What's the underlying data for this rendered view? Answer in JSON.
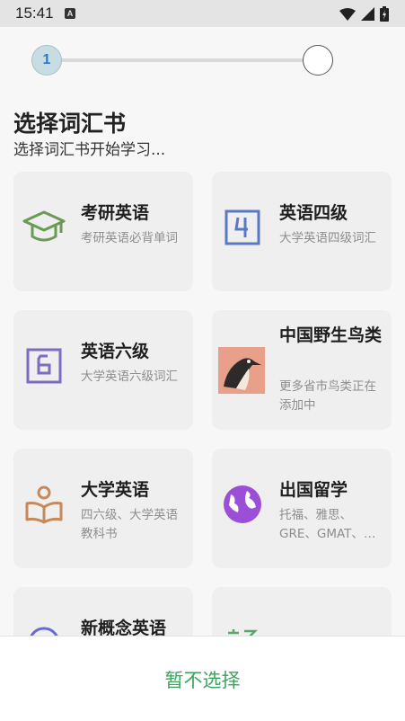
{
  "status_bar": {
    "time": "15:41",
    "notification_icon": "a-icon"
  },
  "stepper": {
    "current_step": "1",
    "total_steps": 2
  },
  "header": {
    "title": "选择词汇书",
    "subtitle": "选择词汇书开始学习..."
  },
  "books": [
    {
      "name": "考研英语",
      "desc": "考研英语必背单词",
      "icon": "graduation-cap-icon",
      "color": "#6b9a57"
    },
    {
      "name": "英语四级",
      "desc": "大学英语四级词汇",
      "icon": "number-4-icon",
      "color": "#5a79c4"
    },
    {
      "name": "英语六级",
      "desc": "大学英语六级词汇",
      "icon": "number-6-icon",
      "color": "#7d6cc0"
    },
    {
      "name": "中国野生鸟类",
      "desc": "更多省市鸟类正在添加中",
      "icon": "bird-image",
      "color": "#e9a08a"
    },
    {
      "name": "大学英语",
      "desc": "四六级、大学英语教科书",
      "icon": "open-book-reader-icon",
      "color": "#c8895a"
    },
    {
      "name": "出国留学",
      "desc": "托福、雅思、GRE、GMAT、…",
      "icon": "globe-icon",
      "color": "#9b4fd6"
    },
    {
      "name": "新概念英语",
      "desc": "",
      "icon": "circle-icon",
      "color": "#6a6ad0"
    },
    {
      "name": "",
      "desc": "",
      "icon": "green-text-icon",
      "color": "#5aa56a"
    }
  ],
  "footer": {
    "skip_label": "暂不选择"
  }
}
